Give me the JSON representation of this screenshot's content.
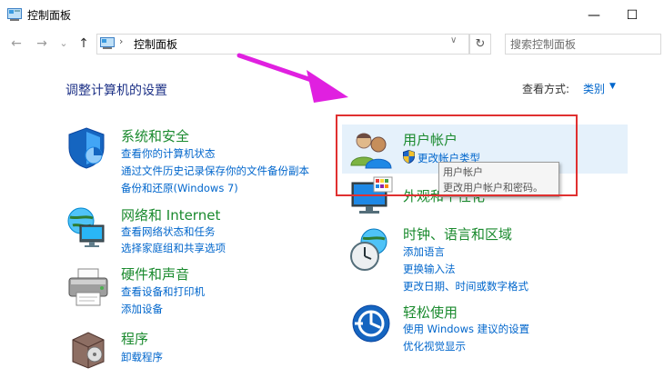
{
  "window": {
    "title": "控制面板",
    "minimize_glyph": "—",
    "maximize_glyph": "☐"
  },
  "nav": {
    "back_glyph": "←",
    "forward_glyph": "→",
    "recent_glyph": "⌄",
    "up_glyph": "↑",
    "breadcrumb_sep": "›",
    "address_text": "控制面板",
    "address_dropdown_glyph": "∨",
    "refresh_glyph": "↻",
    "search_placeholder": "搜索控制面板"
  },
  "header": {
    "heading": "调整计算机的设置",
    "view_by_label": "查看方式:",
    "view_by_value": "类别"
  },
  "categories": [
    {
      "title": "系统和安全",
      "icon": "security-shield-icon",
      "links": [
        "查看你的计算机状态",
        "通过文件历史记录保存你的文件备份副本",
        "备份和还原(Windows 7)"
      ]
    },
    {
      "title": "网络和 Internet",
      "icon": "network-globe-icon",
      "links": [
        "查看网络状态和任务",
        "选择家庭组和共享选项"
      ]
    },
    {
      "title": "硬件和声音",
      "icon": "printer-icon",
      "links": [
        "查看设备和打印机",
        "添加设备"
      ]
    },
    {
      "title": "程序",
      "icon": "programs-box-icon",
      "links": [
        "卸载程序"
      ]
    },
    {
      "title": "用户帐户",
      "icon": "users-icon",
      "links": [
        "更改帐户类型"
      ]
    },
    {
      "title": "外观和个性化",
      "icon": "display-palette-icon",
      "links": []
    },
    {
      "title": "时钟、语言和区域",
      "icon": "clock-globe-icon",
      "links": [
        "添加语言",
        "更换输入法",
        "更改日期、时间或数字格式"
      ]
    },
    {
      "title": "轻松使用",
      "icon": "ease-of-access-icon",
      "links": [
        "使用 Windows 建议的设置",
        "优化视觉显示"
      ]
    }
  ],
  "tooltip": {
    "line1": "用户帐户",
    "line2": "更改用户帐户和密码。"
  },
  "colors": {
    "category_title": "#1a8a2e",
    "link": "#0066cc",
    "annotation_box": "#e03030",
    "annotation_arrow": "#e020e0",
    "hover_bg": "#e5f1fb"
  }
}
